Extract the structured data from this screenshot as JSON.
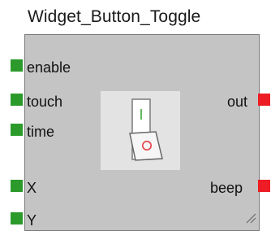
{
  "window": {
    "title": "Widget_Button_Toggle"
  },
  "inputs": [
    {
      "label": "enable"
    },
    {
      "label": "touch"
    },
    {
      "label": "time"
    },
    {
      "label": "X"
    },
    {
      "label": "Y"
    }
  ],
  "outputs": [
    {
      "label": "out"
    },
    {
      "label": "beep"
    }
  ],
  "widget": {
    "icon": "rocker-switch-icon",
    "state_top": "I",
    "state_bottom": "O"
  },
  "colors": {
    "input_port": "#2b9a2b",
    "output_port": "#ee1c24",
    "block": "#c4c4c4"
  }
}
